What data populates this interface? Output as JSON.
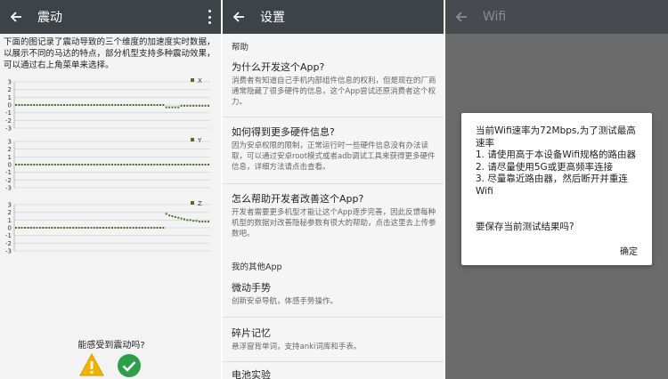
{
  "panel_vibration": {
    "title": "震动",
    "intro": "下面的图记录了震动导致的三个维度的加速度实时数据，以展示不同的马达的特点，部分机型支持多种震动效果，可以通过右上角菜单来选择。",
    "charts": [
      {
        "axis": "x",
        "legend": "X",
        "ticks": [
          "3",
          "2",
          "1",
          "0",
          "-1",
          "-2",
          "-3"
        ]
      },
      {
        "axis": "y",
        "legend": "Y",
        "ticks": [
          "3",
          "2",
          "1",
          "0",
          "-1",
          "-2",
          "-3"
        ]
      },
      {
        "axis": "z",
        "legend": "Z",
        "ticks": [
          "3",
          "2",
          "1",
          "0",
          "-1",
          "-2",
          "-3"
        ]
      }
    ],
    "question": "能感受到震动吗?",
    "icons": {
      "no": "warning-icon",
      "yes": "check-icon"
    },
    "colors": {
      "series": "#556b2f",
      "warn": "#f0b400",
      "ok": "#2e9e4a"
    }
  },
  "chart_data": [
    {
      "type": "line",
      "title": "",
      "legend": "X",
      "ylim": [
        -3,
        3
      ],
      "yticks": [
        3,
        2,
        1,
        0,
        -1,
        -2,
        -3
      ],
      "values": [
        0,
        0,
        0,
        0,
        0,
        0,
        0,
        0,
        0,
        0,
        0,
        0,
        0,
        0,
        0,
        0,
        0,
        0,
        0,
        0,
        0,
        0,
        0,
        0,
        0,
        0,
        0,
        0,
        0,
        0,
        0,
        0,
        0,
        0,
        0,
        0,
        0,
        0,
        0,
        0,
        0,
        0,
        0,
        0,
        0,
        0,
        0,
        0,
        0,
        0,
        -0.3,
        -0.3,
        -0.3,
        -0.3,
        -0.3,
        -0.1,
        -0.1,
        -0.1,
        -0.1,
        -0.1,
        -0.1,
        -0.1,
        -0.1,
        -0.1,
        -0.1
      ]
    },
    {
      "type": "line",
      "title": "",
      "legend": "Y",
      "ylim": [
        -3,
        3
      ],
      "yticks": [
        3,
        2,
        1,
        0,
        -1,
        -2,
        -3
      ],
      "values": [
        0,
        0,
        0,
        0,
        0,
        0,
        0,
        0,
        0,
        0,
        0,
        0,
        0,
        0,
        0,
        0,
        0,
        0,
        0,
        0,
        0,
        0,
        0,
        0,
        0,
        0,
        0,
        0,
        0,
        0,
        0,
        0,
        0,
        0,
        0,
        0,
        0,
        0,
        0,
        0,
        0,
        0,
        0,
        0,
        0,
        0,
        0,
        0,
        0,
        0,
        0,
        0,
        0,
        0,
        0,
        0,
        0,
        0,
        0,
        0,
        0,
        0,
        0,
        0,
        0
      ]
    },
    {
      "type": "line",
      "title": "",
      "legend": "Z",
      "ylim": [
        -3,
        3
      ],
      "yticks": [
        3,
        2,
        1,
        0,
        -1,
        -2,
        -3
      ],
      "values": [
        0,
        0,
        0,
        0,
        0,
        0,
        0,
        0,
        0,
        0,
        0,
        0,
        0,
        0,
        0,
        0,
        0,
        0,
        0,
        0,
        0,
        0,
        0,
        0,
        0,
        0,
        0,
        0,
        0,
        0,
        0,
        0,
        0,
        0,
        0,
        0,
        0,
        0,
        0,
        0,
        0,
        0,
        0,
        0,
        0,
        0,
        0,
        0,
        0,
        0,
        1.8,
        1.6,
        1.5,
        1.4,
        1.3,
        1.2,
        1.1,
        1.0,
        1.0,
        0.9,
        0.9,
        0.8,
        0.8,
        0.8,
        0.8
      ]
    }
  ],
  "panel_settings": {
    "title": "设置",
    "section_help": "帮助",
    "items": [
      {
        "title": "为什么开发这个App?",
        "desc": "消费者有知道自己手机内部组件信息的权利，但是现在的厂商通常隐藏了很多硬件的信息，这个App尝试还原消费者这个权力。"
      },
      {
        "title": "如何得到更多硬件信息?",
        "desc": "因为安卓权限的限制，正常运行时一些硬件信息没有办法读取，可以通过安卓root模式或者adb调试工具来获得更多硬件信息，详细方法请点击查看。"
      },
      {
        "title": "怎么帮助开发者改善这个App?",
        "desc": "开发者需要更多机型才能让这个App逐步完善，因此反馈每种机型的数据对改善隐秘参数有很大的帮助，点击这里去上传参数吧。"
      }
    ],
    "section_other": "我的其他App",
    "other_items": [
      {
        "title": "微动手势",
        "desc": "创新安卓导航，体感手势操作。"
      },
      {
        "title": "碎片记忆",
        "desc": "悬浮窗背单词，支持anki词库和手表。"
      },
      {
        "title": "电池实验",
        "desc": ""
      }
    ]
  },
  "panel_wifi": {
    "title": "Wifi",
    "dialog": {
      "message_lines": [
        "当前Wifi速率为72Mbps,为了测试最高速率",
        "1. 请使用高于本设备Wifi规格的路由器",
        "2. 请尽量使用5G或更高频率连接",
        "3. 尽量靠近路由器，然后断开并重连Wifi"
      ],
      "question": "要保存当前测试结果吗?",
      "confirm": "确定"
    }
  }
}
